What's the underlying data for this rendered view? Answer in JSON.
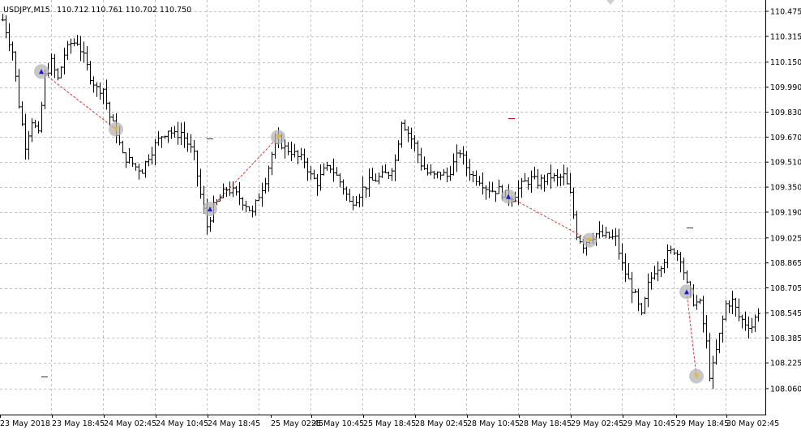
{
  "header": {
    "symbol_timeframe": "USDJPY,M15",
    "ohlc": "110.712 110.761 110.702 110.750"
  },
  "colors": {
    "background": "#ffffff",
    "grid": "#c0c0c0",
    "bars": "#000000",
    "trade_line": "#e03030",
    "buy_marker": "#1a1acc",
    "sell_marker": "#e6b830",
    "trade_circle": "#b4b4b4",
    "level_dash": "#cc0000",
    "level_dash_blue": "#2222cc"
  },
  "chart_data": {
    "type": "ohlc",
    "symbol": "USDJPY",
    "timeframe": "M15",
    "ylim": [
      108.06,
      110.475
    ],
    "y_ticks": [
      110.475,
      110.315,
      110.15,
      109.99,
      109.83,
      109.67,
      109.51,
      109.35,
      109.19,
      109.025,
      108.865,
      108.705,
      108.545,
      108.385,
      108.225,
      108.06
    ],
    "y_tick_labels": [
      "110.475",
      "110.315",
      "110.150",
      "109.990",
      "109.830",
      "109.670",
      "109.510",
      "109.350",
      "109.190",
      "109.025",
      "108.865",
      "108.705",
      "108.545",
      "108.385",
      "108.225",
      "108.060"
    ],
    "x_tick_labels": [
      "23 May 2018",
      "23 May 18:45",
      "24 May 02:45",
      "24 May 10:45",
      "24 May 18:45",
      "25 May 02:45",
      "25 May 10:45",
      "25 May 18:45",
      "28 May 02:45",
      "28 May 10:45",
      "28 May 18:45",
      "29 May 02:45",
      "29 May 10:45",
      "29 May 18:45",
      "30 May 02:45"
    ],
    "x_tick_bar_index": [
      0,
      16,
      32,
      48,
      64,
      80,
      96,
      112,
      128,
      144,
      160,
      176,
      192,
      208,
      224
    ],
    "bar_count": 234,
    "close_path": [
      [
        0,
        110.42
      ],
      [
        3,
        110.22
      ],
      [
        5,
        109.88
      ],
      [
        7,
        109.62
      ],
      [
        9,
        109.78
      ],
      [
        11,
        109.68
      ],
      [
        13,
        110.06
      ],
      [
        15,
        110.15
      ],
      [
        17,
        110.04
      ],
      [
        19,
        110.2
      ],
      [
        21,
        110.27
      ],
      [
        23,
        110.28
      ],
      [
        25,
        110.18
      ],
      [
        27,
        110.06
      ],
      [
        29,
        109.98
      ],
      [
        31,
        109.98
      ],
      [
        33,
        109.8
      ],
      [
        35,
        109.7
      ],
      [
        37,
        109.55
      ],
      [
        39,
        109.52
      ],
      [
        41,
        109.48
      ],
      [
        43,
        109.46
      ],
      [
        45,
        109.55
      ],
      [
        47,
        109.62
      ],
      [
        49,
        109.68
      ],
      [
        51,
        109.72
      ],
      [
        53,
        109.68
      ],
      [
        55,
        109.7
      ],
      [
        57,
        109.63
      ],
      [
        59,
        109.55
      ],
      [
        61,
        109.3
      ],
      [
        63,
        109.1
      ],
      [
        65,
        109.22
      ],
      [
        67,
        109.28
      ],
      [
        69,
        109.34
      ],
      [
        71,
        109.32
      ],
      [
        73,
        109.28
      ],
      [
        75,
        109.24
      ],
      [
        77,
        109.18
      ],
      [
        79,
        109.3
      ],
      [
        81,
        109.4
      ],
      [
        83,
        109.56
      ],
      [
        85,
        109.65
      ],
      [
        87,
        109.6
      ],
      [
        89,
        109.58
      ],
      [
        91,
        109.54
      ],
      [
        93,
        109.52
      ],
      [
        95,
        109.42
      ],
      [
        97,
        109.38
      ],
      [
        99,
        109.45
      ],
      [
        101,
        109.48
      ],
      [
        103,
        109.42
      ],
      [
        105,
        109.35
      ],
      [
        107,
        109.25
      ],
      [
        109,
        109.28
      ],
      [
        111,
        109.34
      ],
      [
        113,
        109.38
      ],
      [
        115,
        109.4
      ],
      [
        117,
        109.42
      ],
      [
        119,
        109.44
      ],
      [
        121,
        109.52
      ],
      [
        123,
        109.78
      ],
      [
        125,
        109.7
      ],
      [
        127,
        109.62
      ],
      [
        129,
        109.5
      ],
      [
        131,
        109.44
      ],
      [
        133,
        109.42
      ],
      [
        135,
        109.44
      ],
      [
        137,
        109.42
      ],
      [
        139,
        109.5
      ],
      [
        141,
        109.58
      ],
      [
        143,
        109.48
      ],
      [
        145,
        109.42
      ],
      [
        147,
        109.4
      ],
      [
        149,
        109.35
      ],
      [
        151,
        109.33
      ],
      [
        153,
        109.33
      ],
      [
        155,
        109.3
      ],
      [
        157,
        109.28
      ],
      [
        159,
        109.34
      ],
      [
        161,
        109.38
      ],
      [
        163,
        109.4
      ],
      [
        165,
        109.38
      ],
      [
        167,
        109.4
      ],
      [
        169,
        109.42
      ],
      [
        171,
        109.4
      ],
      [
        173,
        109.42
      ],
      [
        175,
        109.3
      ],
      [
        177,
        109.05
      ],
      [
        179,
        108.98
      ],
      [
        181,
        109.03
      ],
      [
        183,
        109.05
      ],
      [
        185,
        109.04
      ],
      [
        187,
        109.03
      ],
      [
        189,
        109.02
      ],
      [
        191,
        108.85
      ],
      [
        193,
        108.75
      ],
      [
        195,
        108.65
      ],
      [
        197,
        108.52
      ],
      [
        199,
        108.72
      ],
      [
        201,
        108.82
      ],
      [
        203,
        108.86
      ],
      [
        205,
        108.92
      ],
      [
        207,
        108.95
      ],
      [
        209,
        108.9
      ],
      [
        211,
        108.72
      ],
      [
        213,
        108.62
      ],
      [
        215,
        108.6
      ],
      [
        217,
        108.35
      ],
      [
        218,
        108.15
      ],
      [
        219,
        108.2
      ],
      [
        221,
        108.4
      ],
      [
        223,
        108.6
      ],
      [
        225,
        108.62
      ],
      [
        227,
        108.52
      ],
      [
        229,
        108.48
      ],
      [
        231,
        108.46
      ],
      [
        233,
        108.56
      ],
      [
        234,
        108.68
      ]
    ],
    "trades": [
      {
        "open_bar": 12,
        "open_price": 110.09,
        "open_marker": "buy",
        "close_bar": 35,
        "close_price": 109.72
      },
      {
        "open_bar": 64,
        "open_price": 109.21,
        "open_marker": "buy",
        "close_bar": 85,
        "close_price": 109.67
      },
      {
        "open_bar": 156,
        "open_price": 109.29,
        "open_marker": "buy",
        "close_bar": 181,
        "close_price": 109.01
      },
      {
        "open_bar": 211,
        "open_price": 108.68,
        "open_marker": "buy",
        "close_bar": 214,
        "close_price": 108.14
      }
    ],
    "level_marks": [
      {
        "bar": 64,
        "price": 109.66,
        "color": "red"
      },
      {
        "bar": 157,
        "price": 109.79,
        "color": "red"
      },
      {
        "bar": 212,
        "price": 109.09,
        "color": "red"
      },
      {
        "bar": 13,
        "price": 108.14,
        "color": "blue"
      }
    ],
    "grid": true
  }
}
